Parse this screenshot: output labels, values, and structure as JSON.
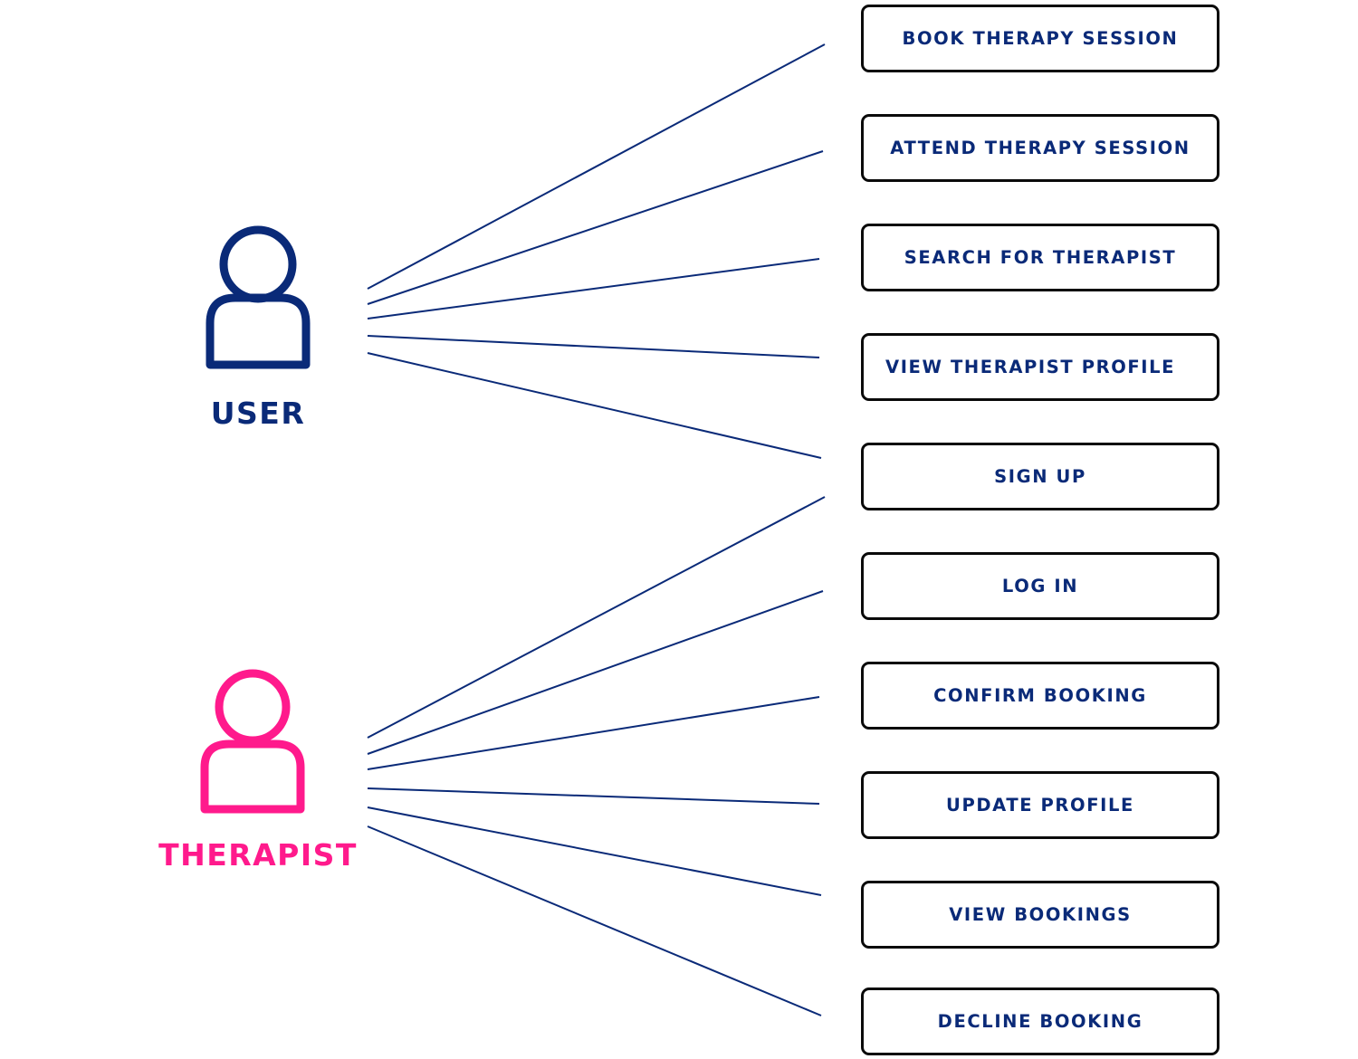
{
  "diagram": {
    "type": "use-case",
    "line_color": "#0a2a78",
    "actors": [
      {
        "id": "user",
        "label": "USER",
        "color": "#0a2a78",
        "icon": "person-outline-icon"
      },
      {
        "id": "therapist",
        "label": "THERAPIST",
        "color": "#ff1a8c",
        "icon": "person-outline-icon"
      }
    ],
    "use_cases": [
      {
        "label": "BOOK THERAPY SESSION"
      },
      {
        "label": "ATTEND THERAPY SESSION"
      },
      {
        "label": "SEARCH FOR THERAPIST"
      },
      {
        "label": "VIEW THERAPIST PROFILE"
      },
      {
        "label": "SIGN UP"
      },
      {
        "label": "LOG IN"
      },
      {
        "label": "CONFIRM BOOKING"
      },
      {
        "label": "UPDATE PROFILE"
      },
      {
        "label": "VIEW BOOKINGS"
      },
      {
        "label": "DECLINE BOOKING"
      }
    ],
    "associations": [
      {
        "actor": "user",
        "use_case": "BOOK THERAPY SESSION"
      },
      {
        "actor": "user",
        "use_case": "ATTEND THERAPY SESSION"
      },
      {
        "actor": "user",
        "use_case": "SEARCH FOR THERAPIST"
      },
      {
        "actor": "user",
        "use_case": "VIEW THERAPIST PROFILE"
      },
      {
        "actor": "user",
        "use_case": "SIGN UP"
      },
      {
        "actor": "therapist",
        "use_case": "SIGN UP"
      },
      {
        "actor": "therapist",
        "use_case": "LOG IN"
      },
      {
        "actor": "therapist",
        "use_case": "CONFIRM BOOKING"
      },
      {
        "actor": "therapist",
        "use_case": "UPDATE PROFILE"
      },
      {
        "actor": "therapist",
        "use_case": "VIEW BOOKINGS"
      },
      {
        "actor": "therapist",
        "use_case": "DECLINE BOOKING"
      }
    ]
  }
}
